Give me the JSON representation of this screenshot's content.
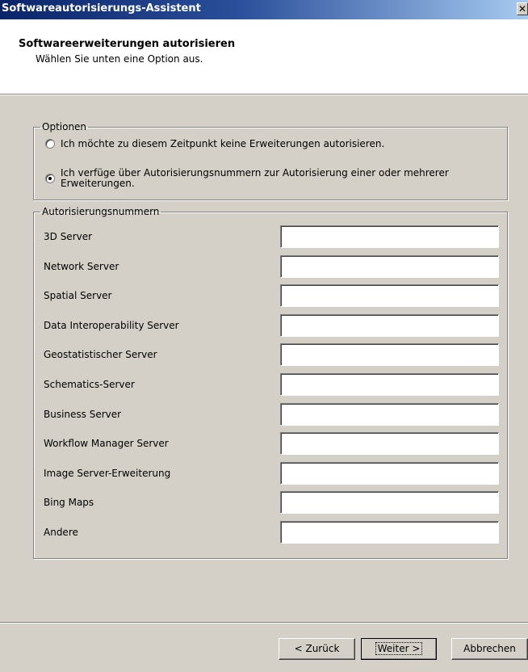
{
  "window": {
    "title": "Softwareautorisierungs-Assistent",
    "close_glyph": "✕"
  },
  "header": {
    "title": "Softwareerweiterungen autorisieren",
    "subtitle": "Wählen Sie unten eine Option aus."
  },
  "options": {
    "legend": "Optionen",
    "items": [
      {
        "label": "Ich möchte zu diesem Zeitpunkt keine Erweiterungen autorisieren.",
        "selected": false
      },
      {
        "label": "Ich verfüge über Autorisierungsnummern zur Autorisierung einer oder mehrerer Erweiterungen.",
        "selected": true
      }
    ]
  },
  "auth": {
    "legend": "Autorisierungsnummern",
    "rows": [
      {
        "label": "3D Server",
        "value": ""
      },
      {
        "label": "Network Server",
        "value": ""
      },
      {
        "label": "Spatial Server",
        "value": ""
      },
      {
        "label": "Data Interoperability Server",
        "value": ""
      },
      {
        "label": "Geostatistischer Server",
        "value": ""
      },
      {
        "label": "Schematics-Server",
        "value": ""
      },
      {
        "label": "Business Server",
        "value": ""
      },
      {
        "label": "Workflow Manager Server",
        "value": ""
      },
      {
        "label": "Image Server-Erweiterung",
        "value": ""
      },
      {
        "label": "Bing Maps",
        "value": ""
      },
      {
        "label": "Andere",
        "value": ""
      }
    ]
  },
  "buttons": {
    "back": "< Zurück",
    "next": "Weiter >",
    "cancel": "Abbrechen"
  }
}
